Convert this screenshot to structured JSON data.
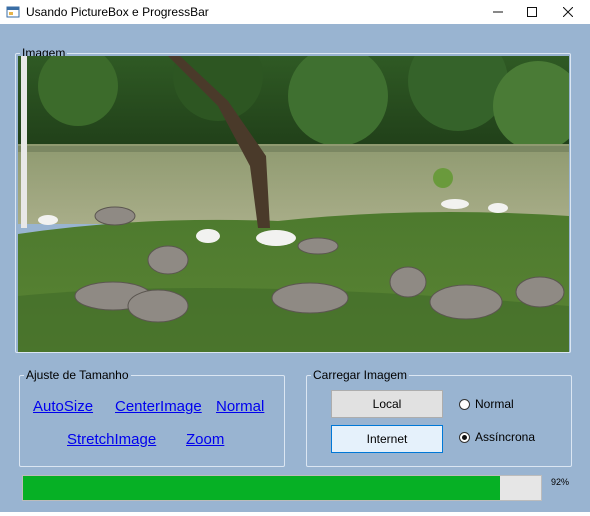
{
  "window": {
    "title": "Usando PictureBox e ProgressBar",
    "icon": "app-form-icon",
    "controls": [
      "minimize-icon",
      "maximize-icon",
      "close-icon"
    ]
  },
  "image_group": {
    "label": "Imagem",
    "picture": "geese-by-lake-photo"
  },
  "ajuste_group": {
    "label": "Ajuste de Tamanho",
    "links": {
      "autosize": "AutoSize",
      "centerimage": "CenterImage",
      "normal": "Normal",
      "stretchimage": "StretchImage",
      "zoom": "Zoom"
    }
  },
  "carregar_group": {
    "label": "Carregar Imagem",
    "local_button": "Local",
    "internet_button": "Internet",
    "radio_normal": "Normal",
    "radio_assincrona": "Assíncrona",
    "selected": "Assíncrona"
  },
  "progress": {
    "value_fraction": 0.92,
    "label": "92%",
    "color": "#06b025"
  }
}
